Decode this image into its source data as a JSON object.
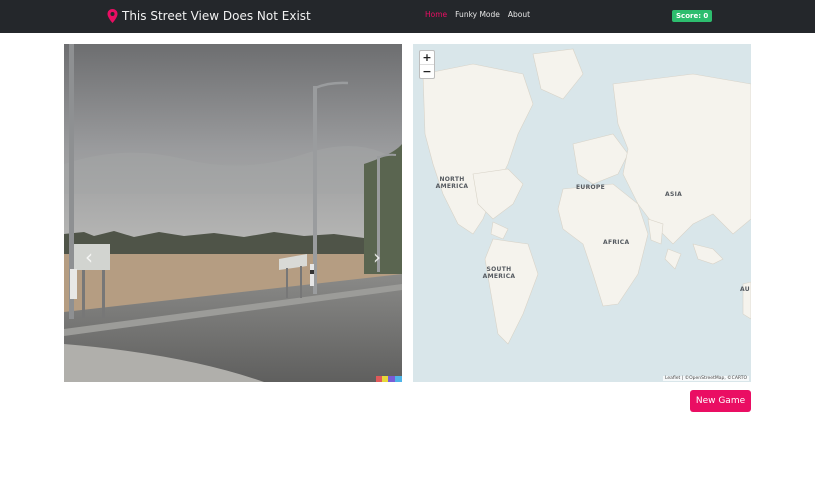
{
  "brand": {
    "title": "This Street View Does Not Exist",
    "icon": "map-pin-icon",
    "icon_color": "#ea0e63"
  },
  "nav": {
    "items": [
      {
        "label": "Home",
        "active": true
      },
      {
        "label": "Funky Mode",
        "active": false
      },
      {
        "label": "About",
        "active": false
      }
    ]
  },
  "score": {
    "label": "Score: 0",
    "color": "#2dbd6e"
  },
  "street_view": {
    "prev_icon": "chevron-left-icon",
    "next_icon": "chevron-right-icon",
    "prev_symbol": "‹",
    "next_symbol": "›"
  },
  "map": {
    "zoom_in": "+",
    "zoom_out": "−",
    "labels": {
      "north_america": "NORTH AMERICA",
      "europe": "EUROPE",
      "asia": "ASIA",
      "africa": "AFRICA",
      "south_america": "SOUTH AMERICA",
      "australia": "AU"
    },
    "attribution": "Leaflet | ©OpenStreetMap, ©CARTO"
  },
  "actions": {
    "new_game": "New Game"
  },
  "colors": {
    "accent": "#ea0e63",
    "navbar": "#24272b",
    "ocean": "#d9e6ea",
    "land": "#f5f3ed"
  }
}
